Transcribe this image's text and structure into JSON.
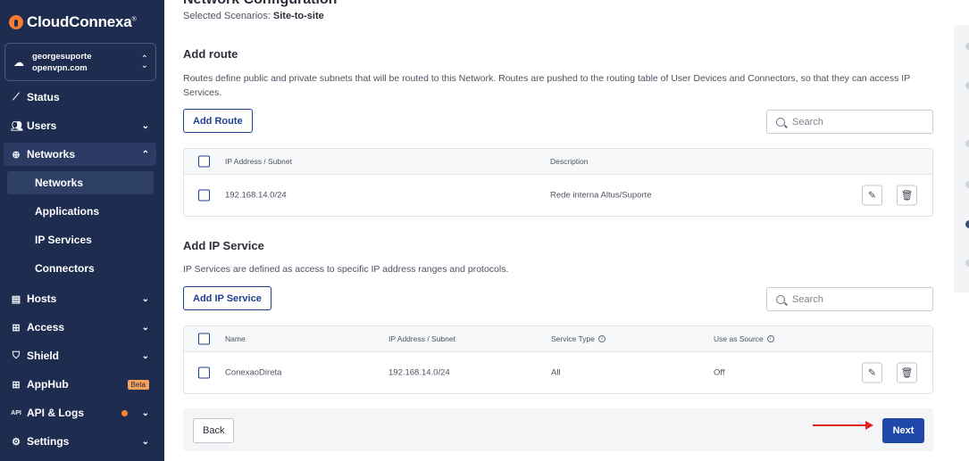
{
  "brand": {
    "name": "CloudConnexa",
    "mark": "®"
  },
  "account": {
    "user": "georgesuporte",
    "domain": "openvpn.com"
  },
  "nav": {
    "status": "Status",
    "users": "Users",
    "networks": "Networks",
    "networks_sub": [
      "Networks",
      "Applications",
      "IP Services",
      "Connectors"
    ],
    "hosts": "Hosts",
    "access": "Access",
    "shield": "Shield",
    "apphub": "AppHub",
    "apphub_badge": "Beta",
    "api": "API & Logs",
    "settings": "Settings"
  },
  "page": {
    "title": "Network Configuration",
    "scenario_label": "Selected Scenarios:",
    "scenario_value": "Site-to-site"
  },
  "routes": {
    "title": "Add route",
    "description": "Routes define public and private subnets that will be routed to this Network. Routes are pushed to the routing table of User Devices and Connectors, so that they can access IP Services.",
    "add_button": "Add Route",
    "search_placeholder": "Search",
    "columns": [
      "IP Address / Subnet",
      "Description"
    ],
    "rows": [
      {
        "subnet": "192.168.14.0/24",
        "description": "Rede interna Altus/Suporte"
      }
    ]
  },
  "ip_services": {
    "title": "Add IP Service",
    "description": "IP Services are defined as access to specific IP address ranges and protocols.",
    "add_button": "Add IP Service",
    "search_placeholder": "Search",
    "columns": [
      "Name",
      "IP Address / Subnet",
      "Service Type",
      "Use as Source"
    ],
    "rows": [
      {
        "name": "ConexaoDireta",
        "subnet": "192.168.14.0/24",
        "service_type": "All",
        "use_as_source": "Off"
      }
    ]
  },
  "footer": {
    "back": "Back",
    "next": "Next"
  },
  "colors": {
    "sidebar": "#1d2c4f",
    "primary": "#1f48a8",
    "accent": "#f57c32",
    "annotation_arrow": "#e02020"
  }
}
